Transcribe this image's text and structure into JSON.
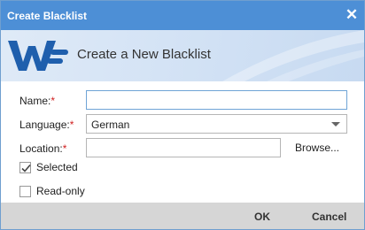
{
  "window": {
    "title": "Create Blacklist",
    "close_icon": "close-icon"
  },
  "banner": {
    "heading": "Create a New Blacklist",
    "logo": "wf-logo",
    "logo_color": "#1f5fad"
  },
  "form": {
    "name": {
      "label": "Name:",
      "required_mark": "*",
      "value": ""
    },
    "language": {
      "label": "Language:",
      "required_mark": "*",
      "selected": "German"
    },
    "location": {
      "label": "Location:",
      "required_mark": "*",
      "value": "",
      "browse_label": "Browse..."
    },
    "selected": {
      "label": "Selected",
      "checked": true
    },
    "readonly": {
      "label": "Read-only",
      "checked": false
    }
  },
  "footer": {
    "ok_label": "OK",
    "cancel_label": "Cancel"
  },
  "colors": {
    "titlebar": "#4d8fd6",
    "required": "#d02020",
    "footer": "#d6d6d6"
  }
}
